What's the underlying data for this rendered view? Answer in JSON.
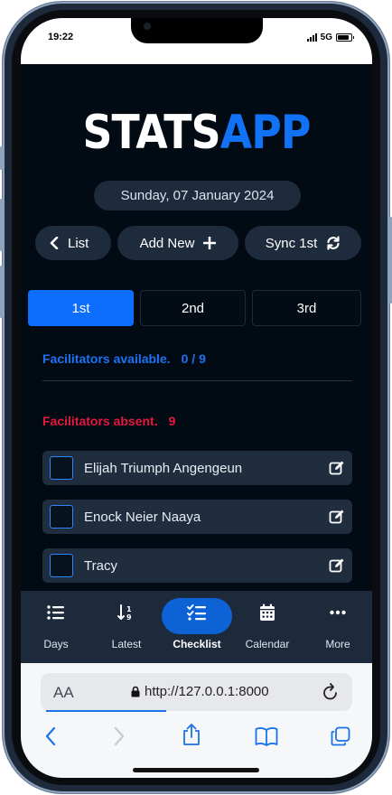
{
  "status_bar": {
    "time": "19:22",
    "network": "5G"
  },
  "logo": {
    "part1": "STATS",
    "part2": "APP"
  },
  "date": "Sunday, 07 January 2024",
  "actions": {
    "list_label": "List",
    "add_label": "Add New",
    "sync_label": "Sync 1st"
  },
  "tabs": [
    "1st",
    "2nd",
    "3rd"
  ],
  "active_tab": "1st",
  "available": {
    "label": "Facilitators available.",
    "count": "0 / 9"
  },
  "absent": {
    "label": "Facilitators absent.",
    "count": "9"
  },
  "facilitators": [
    {
      "name": "Elijah Triumph Angengeun"
    },
    {
      "name": "Enock Neier Naaya"
    },
    {
      "name": "Tracy"
    }
  ],
  "bottom_nav": [
    {
      "label": "Days",
      "icon": "list-icon"
    },
    {
      "label": "Latest",
      "icon": "sort-icon"
    },
    {
      "label": "Checklist",
      "icon": "checklist-icon",
      "active": true
    },
    {
      "label": "Calendar",
      "icon": "calendar-icon"
    },
    {
      "label": "More",
      "icon": "ellipsis-icon"
    }
  ],
  "browser": {
    "text_size_label": "AA",
    "url": "http://127.0.0.1:8000"
  },
  "colors": {
    "background": "#020b14",
    "accent": "#0d6efd",
    "available": "#1d72f2",
    "absent": "#e5193d",
    "surface": "#1e2b3d"
  }
}
